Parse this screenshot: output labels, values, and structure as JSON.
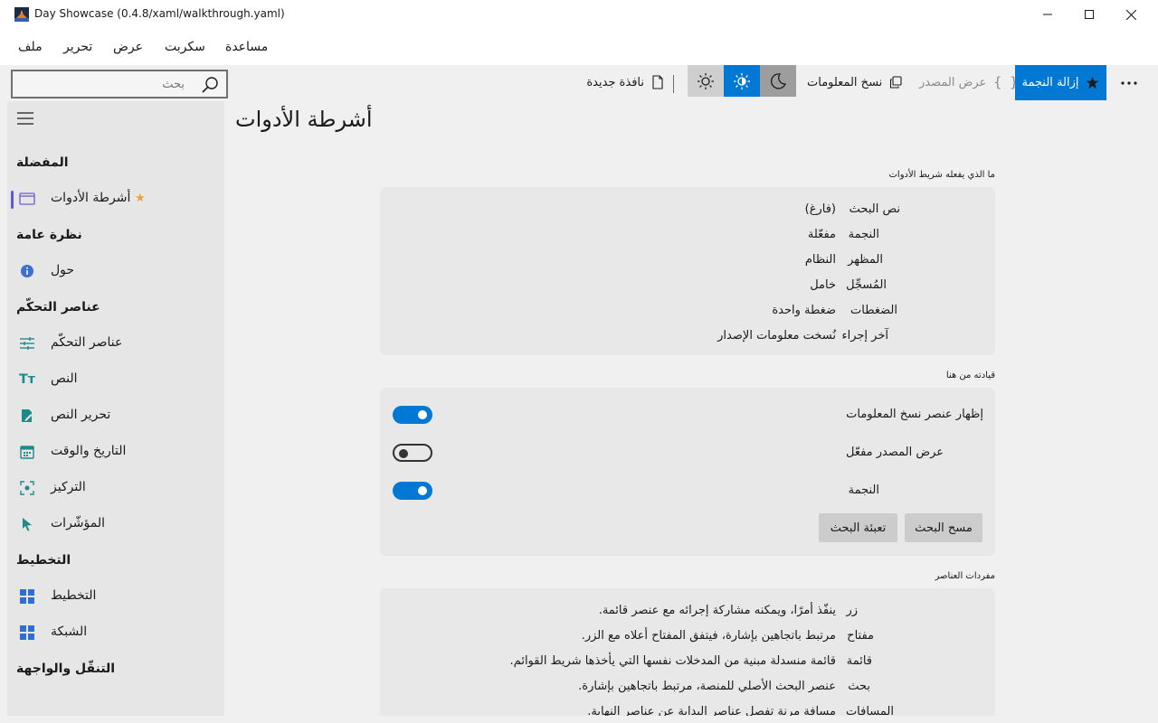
{
  "window": {
    "title": "Day Showcase (0.4.8/xaml/walkthrough.yaml)"
  },
  "menu": {
    "file": "ملف",
    "edit": "تحرير",
    "view": "عرض",
    "script": "سكربت",
    "help": "مساعدة"
  },
  "toolbar": {
    "search_placeholder": "بحث",
    "new_window": "نافذة جديدة",
    "copy_info": "نسخ المعلومات",
    "view_source": "عرض المصدر",
    "unstar": "إزالة النجمة",
    "accent_color": "#0078d4"
  },
  "sidebar": {
    "sections": {
      "favorites": "المفضلة",
      "overview": "نظرة عامة",
      "controls": "عناصر التحكّم",
      "layout": "التخطيط",
      "navigation": "التنقّل والواجهة"
    },
    "items": {
      "toolbars": "أشرطة الأدوات",
      "about": "حول",
      "controls": "عناصر التحكّم",
      "text": "النص",
      "text_edit": "تحرير النص",
      "datetime": "التاريخ والوقت",
      "focus": "التركيز",
      "pointers": "المؤشّرات",
      "layout": "التخطيط",
      "grid": "الشبكة"
    }
  },
  "main": {
    "title": "أشرطة الأدوات",
    "section1": {
      "title": "ما الذي يفعله شريط الأدوات",
      "rows": [
        {
          "key": "نص البحث",
          "value": "(فارغ)"
        },
        {
          "key": "النجمة",
          "value": "مفعّلة"
        },
        {
          "key": "المظهر",
          "value": "النظام"
        },
        {
          "key": "المُسجِّل",
          "value": "خامل"
        },
        {
          "key": "الضغطات",
          "value": "ضغطة واحدة"
        },
        {
          "key": "آخر إجراء",
          "value": "نُسخت معلومات الإصدار"
        }
      ]
    },
    "section2": {
      "title": "قيادته من هنا",
      "toggles": [
        {
          "label": "إظهار عنصر نسخ المعلومات",
          "on": true
        },
        {
          "label": "عرض المصدر مفعّل",
          "on": false
        },
        {
          "label": "النجمة",
          "on": true
        }
      ],
      "clear_search": "مسح البحث",
      "fill_search": "تعبئة البحث"
    },
    "section3": {
      "title": "مفردات العناصر",
      "rows": [
        {
          "key": "زر",
          "value": "ينفّذ أمرًا، ويمكنه مشاركة إجرائه مع عنصر قائمة."
        },
        {
          "key": "مفتاح",
          "value": "مرتبط باتجاهين بإشارة، فيتفق المفتاح أعلاه مع الزر."
        },
        {
          "key": "قائمة",
          "value": "قائمة منسدلة مبنية من المدخلات نفسها التي يأخذها شريط القوائم."
        },
        {
          "key": "بحث",
          "value": "عنصر البحث الأصلي للمنصة، مرتبط باتجاهين بإشارة."
        },
        {
          "key": "المسافات",
          "value": "مسافة مرنة تفصل عناصر البداية عن عناصر النهاية."
        }
      ]
    }
  }
}
